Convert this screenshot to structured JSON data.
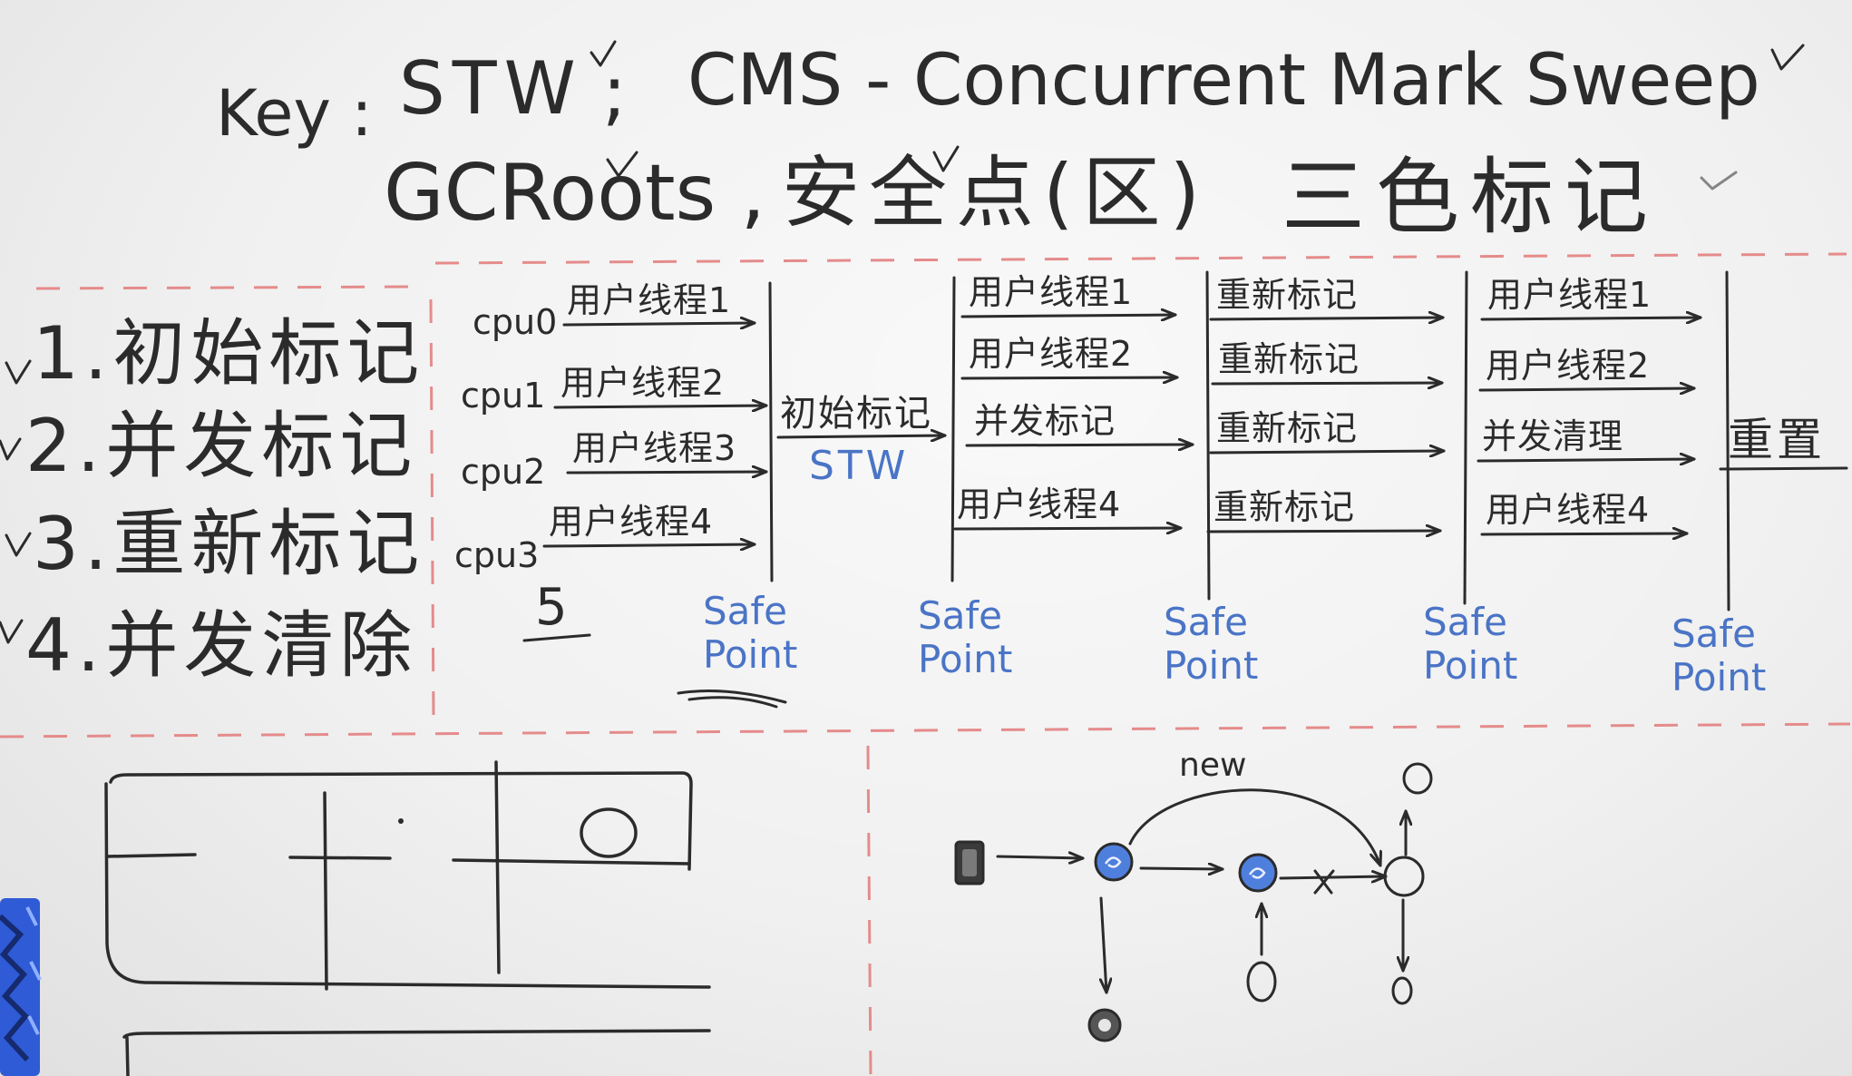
{
  "header": {
    "key_label": "Key :",
    "stw": "STW",
    "separator": ";",
    "cms": "CMS - Concurrent Mark Sweep",
    "gcroots": "GCRoots ,",
    "safe_region": "安全点(区)",
    "tricolor": "三色标记"
  },
  "phases": [
    "1.初始标记",
    "2.并发标记",
    "3.重新标记",
    "4.并发清除"
  ],
  "timeline": {
    "cpus": [
      "cpu0",
      "cpu1",
      "cpu2",
      "cpu3"
    ],
    "stage1_threads": [
      "用户线程1",
      "用户线程2",
      "用户线程3",
      "用户线程4"
    ],
    "count_note": "5",
    "initial_mark": "初始标记",
    "initial_mark_note": "STW",
    "stage2_rows": [
      "用户线程1",
      "用户线程2",
      "并发标记",
      "用户线程4"
    ],
    "stage3_rows": [
      "重新标记",
      "重新标记",
      "重新标记",
      "重新标记"
    ],
    "stage4_rows": [
      "用户线程1",
      "用户线程2",
      "并发清理",
      "用户线程4"
    ],
    "reset": "重置",
    "safe_point": "Safe Point"
  },
  "object_graph": {
    "new_edge_label": "new"
  },
  "colors": {
    "board": "#eeeeee",
    "ink": "#2b2b2b",
    "blue_ink": "#4a74c6",
    "red_dash": "#e58b8b",
    "node_blue": "#4f7fdc",
    "marker_blue": "#2f5bd6"
  }
}
